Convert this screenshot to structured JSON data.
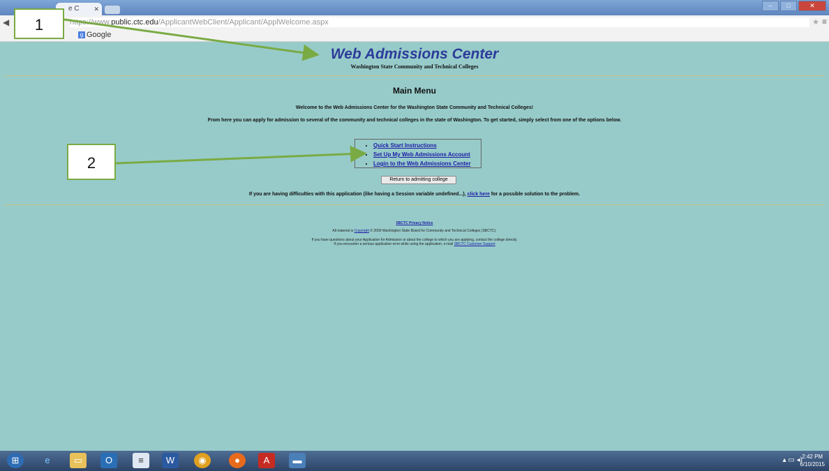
{
  "browser": {
    "tab_label": "e C",
    "url_scheme": "https://www.",
    "url_host": "public.ctc.edu",
    "url_path": "/ApplicantWebClient/Applicant/ApplWelcome.aspx",
    "bookmark_label": "Google"
  },
  "header": {
    "title": "Web Admissions Center",
    "subtitle": "Washington State Community and Technical Colleges"
  },
  "main": {
    "menu_title": "Main Menu",
    "welcome": "Welcome to the Web Admissions Center for the Washington State Community and Technical Colleges!",
    "intro": "From here you can apply for admission to several of the community and technical colleges in the state of Washington. To get started, simply select from one of the options below.",
    "options": [
      {
        "label": "Quick Start Instructions"
      },
      {
        "label": "Set Up My Web Admissions Account"
      },
      {
        "label": "Login to the Web Admissions Center"
      }
    ],
    "return_button": "Return to admitting college",
    "difficulty_prefix": "If you are having difficulties with this application (like having a Session variable undefined...),",
    "difficulty_link": "click here",
    "difficulty_suffix": "for a possible solution to the problem."
  },
  "footer": {
    "privacy_link": "SBCTC Privacy Notice",
    "copyright_prefix": "All material is",
    "copyright_link": "Copyright",
    "copyright_suffix": "© 2009 Washington State Board for Community and Technical Colleges (SBCTC).",
    "contact_line1": "If you have questions about your Application for Admission or about the college to which you are applying, contact the college directly.",
    "contact_line2_prefix": "If you encounter a serious application error while using the application, e-mail",
    "contact_link": "SBCTC Customer Support"
  },
  "callouts": {
    "one": "1",
    "two": "2",
    "arrow_color": "#7aaa44"
  },
  "taskbar": {
    "icons": [
      "windows-start-icon",
      "ie-icon",
      "explorer-icon",
      "outlook-icon",
      "notepad-icon",
      "word-icon",
      "chrome-icon",
      "firefox-icon",
      "acrobat-icon",
      "folder-icon"
    ],
    "time": "2:42 PM",
    "date": "6/10/2015"
  }
}
